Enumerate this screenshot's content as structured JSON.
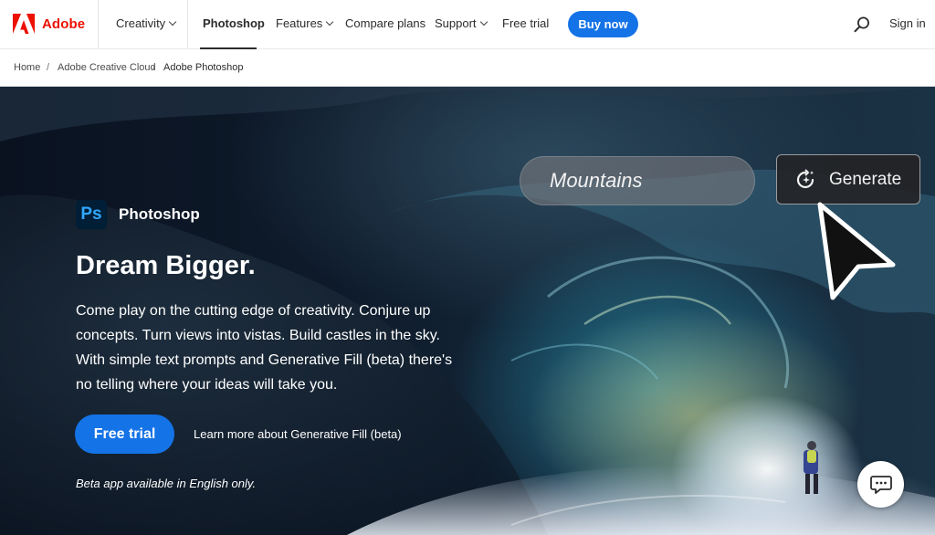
{
  "header": {
    "brand": "Adobe",
    "nav": {
      "creativity": "Creativity",
      "photoshop": "Photoshop",
      "features": "Features",
      "compare_plans": "Compare plans",
      "support": "Support",
      "free_trial": "Free trial"
    },
    "buy_now": "Buy now",
    "sign_in": "Sign in",
    "search_icon": "search-icon"
  },
  "breadcrumb": [
    "Home",
    "Adobe Creative Cloud",
    "Adobe Photoshop"
  ],
  "breadcrumb_separator": "/",
  "hero": {
    "prompt_text": "Mountains",
    "generate_label": "Generate",
    "app_badge": "Ps",
    "app_name": "Photoshop",
    "title": "Dream Bigger.",
    "description": "Come play on the cutting edge of creativity. Conjure up concepts. Turn views into vistas. Build castles in the sky. With simple text prompts and Generative Fill (beta) there's no telling where your ideas will take you.",
    "cta_label": "Free trial",
    "learn_more": "Learn more about Generative Fill (beta)",
    "beta_note": "Beta app available in English only."
  },
  "colors": {
    "adobe_red": "#eb1000",
    "primary_blue": "#1473e6",
    "ps_blue": "#31a8ff",
    "ps_dark": "#001e36"
  },
  "icons": [
    "adobe-logo-icon",
    "chevron-down-icon",
    "search-icon",
    "sparkle-refresh-icon",
    "pointer-cursor-icon",
    "chat-icon"
  ]
}
